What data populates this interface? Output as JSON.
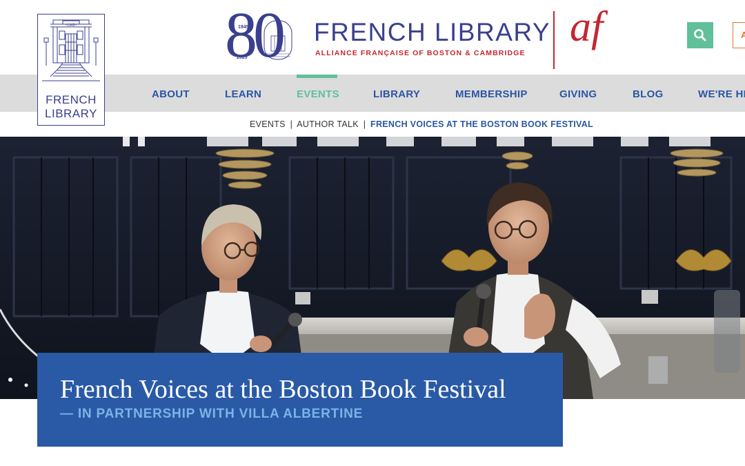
{
  "header": {
    "logo": {
      "line1": "FRENCH",
      "line2": "LIBRARY",
      "year": "~1945~"
    },
    "anniversary": {
      "number": "80",
      "year_start": "1945",
      "year_end": "2025"
    },
    "brand_title": "FRENCH LIBRARY",
    "brand_subtitle": "ALLIANCE FRANÇAISE OF BOSTON & CAMBRIDGE",
    "af_logo": "af",
    "edge_button_label": "A",
    "colors": {
      "brand_blue": "#3a3f8e",
      "brand_red": "#c42731",
      "accent_green": "#5fc09a"
    }
  },
  "nav": {
    "items": [
      {
        "label": "ABOUT",
        "active": false
      },
      {
        "label": "LEARN",
        "active": false
      },
      {
        "label": "EVENTS",
        "active": true
      },
      {
        "label": "LIBRARY",
        "active": false
      },
      {
        "label": "MEMBERSHIP",
        "active": false
      },
      {
        "label": "GIVING",
        "active": false
      },
      {
        "label": "BLOG",
        "active": false
      },
      {
        "label": "WE'RE HI",
        "active": false
      }
    ]
  },
  "breadcrumb": {
    "items": [
      "EVENTS",
      "AUTHOR TALK",
      "FRENCH VOICES AT THE BOSTON BOOK FESTIVAL"
    ],
    "separator": "|"
  },
  "hero": {
    "title": "French Voices at the Boston Book Festival",
    "subtitle": "— IN PARTNERSHIP WITH VILLA ALBERTINE"
  }
}
